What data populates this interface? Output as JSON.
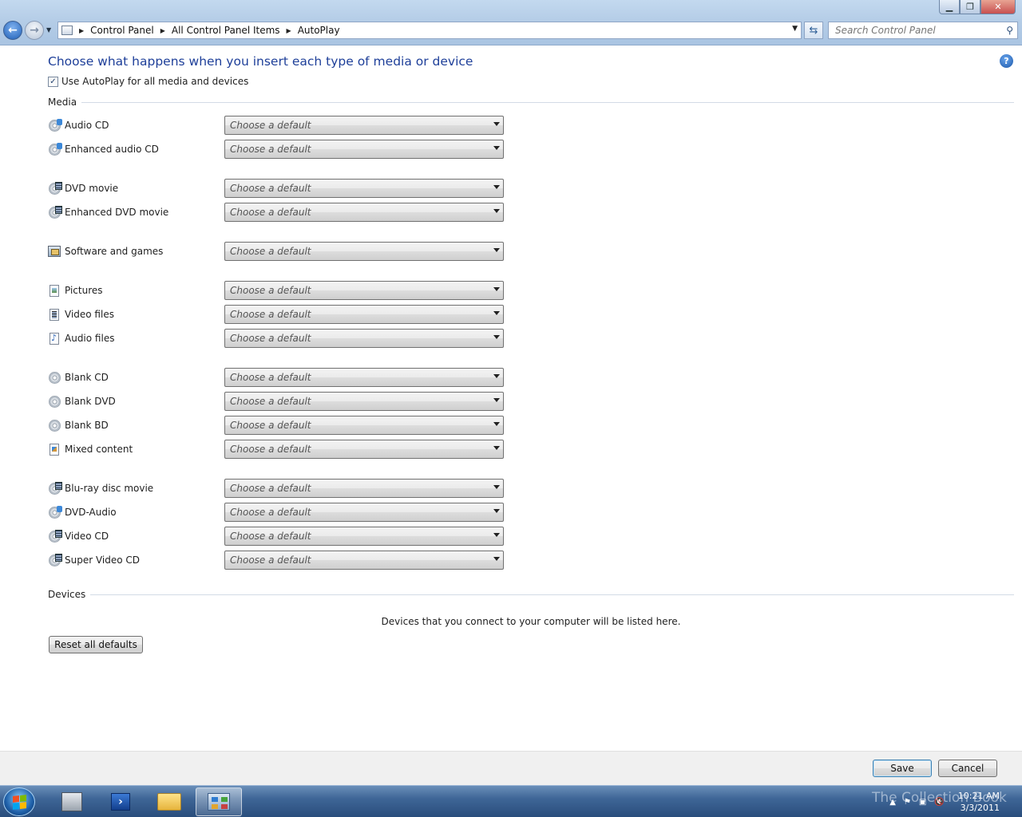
{
  "window": {
    "controls": [
      "minimize",
      "restore",
      "close"
    ]
  },
  "address_bar": {
    "breadcrumbs": [
      "Control Panel",
      "All Control Panel Items",
      "AutoPlay"
    ]
  },
  "search": {
    "placeholder": "Search Control Panel"
  },
  "main": {
    "heading": "Choose what happens when you insert each type of media or device",
    "autoplay_checkbox": {
      "label": "Use AutoPlay for all media and devices",
      "checked": true
    },
    "media_section_title": "Media",
    "media_items": [
      {
        "label": "Audio CD",
        "icon": "audio-cd-icon",
        "value": "Choose a default"
      },
      {
        "label": "Enhanced audio CD",
        "icon": "enhanced-audio-cd-icon",
        "value": "Choose a default"
      },
      {
        "label": "DVD movie",
        "icon": "dvd-movie-icon",
        "value": "Choose a default"
      },
      {
        "label": "Enhanced DVD movie",
        "icon": "enhanced-dvd-movie-icon",
        "value": "Choose a default"
      },
      {
        "label": "Software and games",
        "icon": "software-games-icon",
        "value": "Choose a default"
      },
      {
        "label": "Pictures",
        "icon": "pictures-icon",
        "value": "Choose a default"
      },
      {
        "label": "Video files",
        "icon": "video-files-icon",
        "value": "Choose a default"
      },
      {
        "label": "Audio files",
        "icon": "audio-files-icon",
        "value": "Choose a default"
      },
      {
        "label": "Blank CD",
        "icon": "blank-cd-icon",
        "value": "Choose a default"
      },
      {
        "label": "Blank DVD",
        "icon": "blank-dvd-icon",
        "value": "Choose a default"
      },
      {
        "label": "Blank BD",
        "icon": "blank-bd-icon",
        "value": "Choose a default"
      },
      {
        "label": "Mixed content",
        "icon": "mixed-content-icon",
        "value": "Choose a default"
      },
      {
        "label": "Blu-ray disc movie",
        "icon": "bluray-movie-icon",
        "value": "Choose a default"
      },
      {
        "label": "DVD-Audio",
        "icon": "dvd-audio-icon",
        "value": "Choose a default"
      },
      {
        "label": "Video CD",
        "icon": "video-cd-icon",
        "value": "Choose a default"
      },
      {
        "label": "Super Video CD",
        "icon": "super-video-cd-icon",
        "value": "Choose a default"
      }
    ],
    "devices_section_title": "Devices",
    "devices_empty_text": "Devices that you connect to your computer will be listed here.",
    "reset_button": "Reset all defaults"
  },
  "footer": {
    "save": "Save",
    "cancel": "Cancel"
  },
  "taskbar": {
    "pinned": [
      "server-manager-icon",
      "powershell-icon",
      "explorer-folder-icon",
      "control-panel-icon"
    ],
    "clock_time": "10:21 AM",
    "clock_date": "3/3/2011",
    "watermark": "The Collection Book"
  },
  "colors": {
    "heading": "#1e3f99",
    "taskbar": "#3f6697",
    "chrome": "#b5cde7"
  }
}
